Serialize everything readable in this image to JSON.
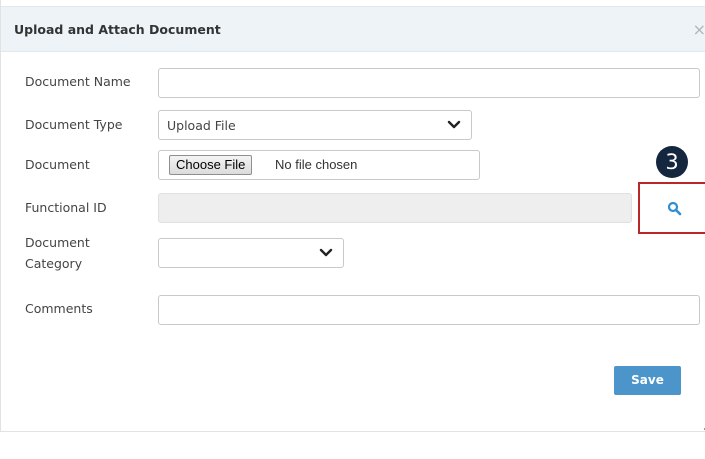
{
  "dialog": {
    "title": "Upload and Attach Document",
    "close_label": "×"
  },
  "form": {
    "document_name": {
      "label": "Document Name",
      "value": ""
    },
    "document_type": {
      "label": "Document Type",
      "selected": "Upload File"
    },
    "document": {
      "label": "Document",
      "button_label": "Choose File",
      "status": "No file chosen"
    },
    "functional_id": {
      "label": "Functional ID",
      "value": "",
      "search_icon": "search-icon"
    },
    "document_category": {
      "label_line1": "Document",
      "label_line2": "Category",
      "selected": ""
    },
    "comments": {
      "label": "Comments",
      "value": ""
    }
  },
  "annotation": {
    "step_number": "3",
    "highlight_color": "#b92727",
    "badge_color": "#15263f"
  },
  "actions": {
    "save_label": "Save"
  },
  "colors": {
    "header_bg": "#eef3f7",
    "accent": "#4b95cb",
    "icon_blue": "#2f8fd0"
  }
}
